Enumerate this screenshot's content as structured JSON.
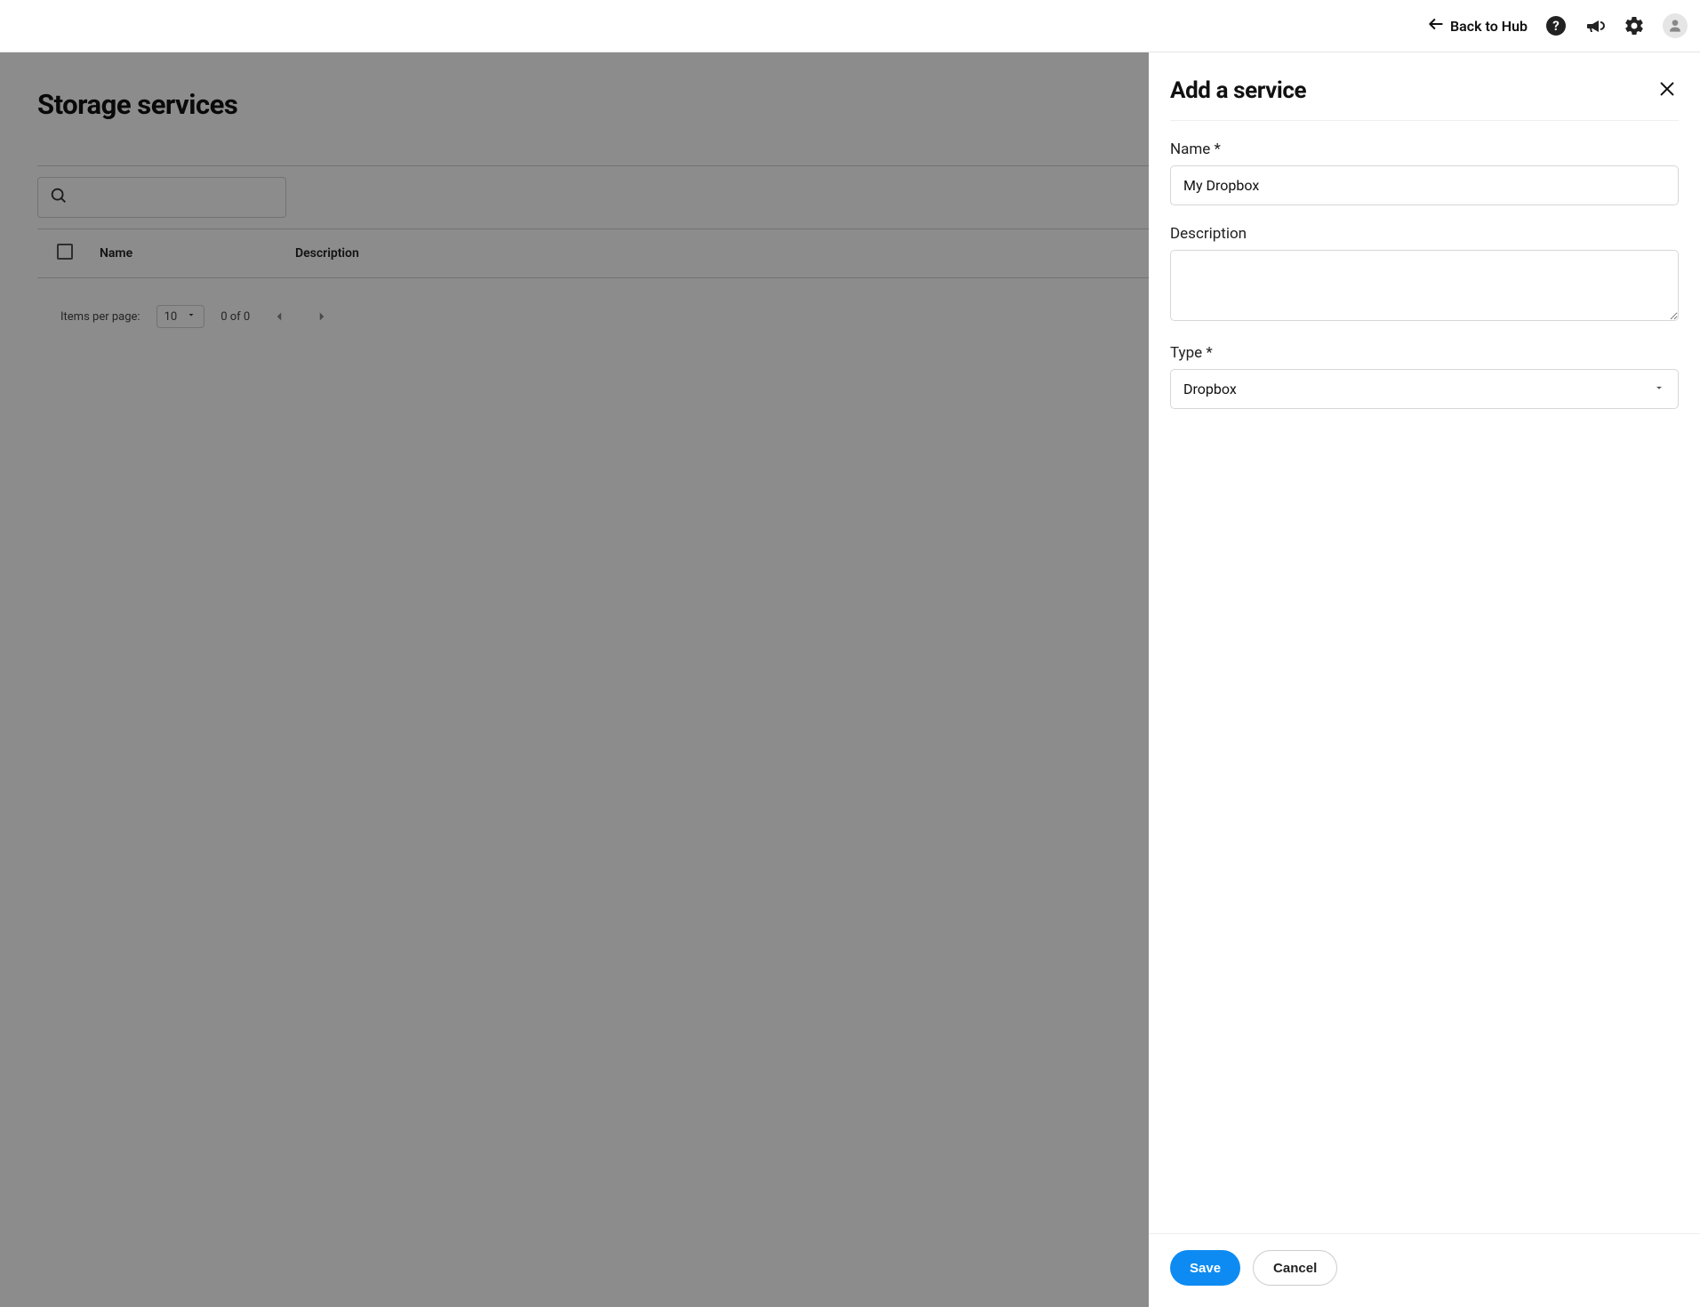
{
  "topbar": {
    "back_label": "Back to Hub"
  },
  "page": {
    "title": "Storage services",
    "table": {
      "columns": [
        "Name",
        "Description"
      ]
    },
    "paginator": {
      "items_per_page_label": "Items per page:",
      "page_size": "10",
      "range_text": "0 of 0"
    }
  },
  "panel": {
    "title": "Add a service",
    "fields": {
      "name": {
        "label": "Name *",
        "value": "My Dropbox"
      },
      "description": {
        "label": "Description",
        "value": ""
      },
      "type": {
        "label": "Type *",
        "value": "Dropbox"
      }
    },
    "buttons": {
      "save": "Save",
      "cancel": "Cancel"
    }
  }
}
